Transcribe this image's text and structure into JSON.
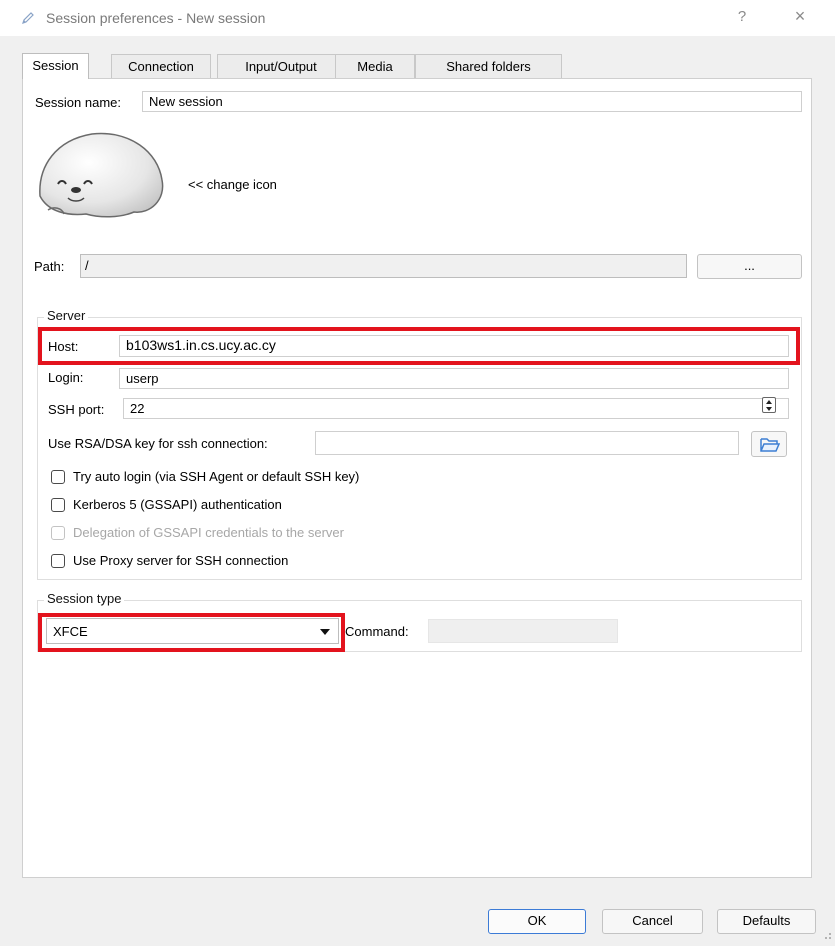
{
  "window": {
    "title": "Session preferences - New session",
    "help_label": "?",
    "close_label": "×"
  },
  "tabs": [
    {
      "label": "Session",
      "active": true
    },
    {
      "label": "Connection",
      "active": false
    },
    {
      "label": "Input/Output",
      "active": false
    },
    {
      "label": "Media",
      "active": false
    },
    {
      "label": "Shared folders",
      "active": false
    }
  ],
  "session": {
    "name_label": "Session name:",
    "name_value": "New session",
    "change_icon_label": "<< change icon",
    "path_label": "Path:",
    "path_value": "/",
    "browse_label": "..."
  },
  "server": {
    "group_title": "Server",
    "host_label": "Host:",
    "host_value": "b103ws1.in.cs.ucy.ac.cy",
    "login_label": "Login:",
    "login_value": "userp",
    "ssh_port_label": "SSH port:",
    "ssh_port_value": "22",
    "rsa_key_label": "Use RSA/DSA key for ssh connection:",
    "rsa_key_value": "",
    "checkboxes": [
      {
        "label": "Try auto login (via SSH Agent or default SSH key)",
        "checked": false,
        "enabled": true
      },
      {
        "label": "Kerberos 5 (GSSAPI) authentication",
        "checked": false,
        "enabled": true
      },
      {
        "label": "Delegation of GSSAPI credentials to the server",
        "checked": false,
        "enabled": false
      },
      {
        "label": "Use Proxy server for SSH connection",
        "checked": false,
        "enabled": true
      }
    ]
  },
  "session_type": {
    "group_title": "Session type",
    "selected": "XFCE",
    "command_label": "Command:",
    "command_value": ""
  },
  "buttons": {
    "ok": "OK",
    "cancel": "Cancel",
    "defaults": "Defaults"
  },
  "colors": {
    "highlight": "#e3131d",
    "default_button_border": "#3c7bd6"
  },
  "icons": {
    "title_icon": "pencil-icon",
    "session_icon": "seal-icon",
    "folder_icon": "folder-open-icon"
  }
}
